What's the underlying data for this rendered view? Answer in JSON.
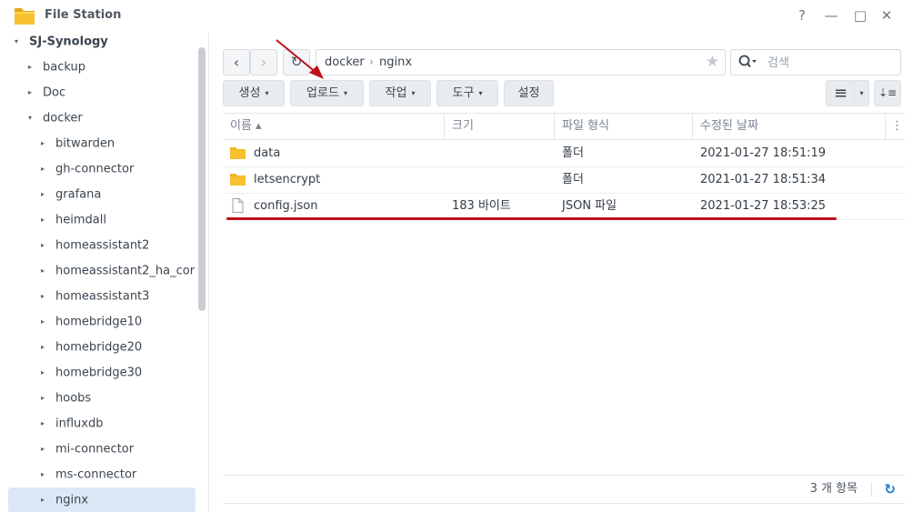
{
  "app": {
    "title": "File Station"
  },
  "window": {
    "help": "?",
    "minimize": "—",
    "maximize": "□",
    "close": "✕"
  },
  "sidebar": {
    "items": [
      {
        "label": "SJ-Synology",
        "arrow": "▾"
      },
      {
        "label": "backup",
        "arrow": "▸"
      },
      {
        "label": "Doc",
        "arrow": "▸"
      },
      {
        "label": "docker",
        "arrow": "▾"
      },
      {
        "label": "bitwarden",
        "arrow": "▸"
      },
      {
        "label": "gh-connector",
        "arrow": "▸"
      },
      {
        "label": "grafana",
        "arrow": "▸"
      },
      {
        "label": "heimdall",
        "arrow": "▸"
      },
      {
        "label": "homeassistant2",
        "arrow": "▸"
      },
      {
        "label": "homeassistant2_ha_cor",
        "arrow": "▸"
      },
      {
        "label": "homeassistant3",
        "arrow": "▸"
      },
      {
        "label": "homebridge10",
        "arrow": "▸"
      },
      {
        "label": "homebridge20",
        "arrow": "▸"
      },
      {
        "label": "homebridge30",
        "arrow": "▸"
      },
      {
        "label": "hoobs",
        "arrow": "▸"
      },
      {
        "label": "influxdb",
        "arrow": "▸"
      },
      {
        "label": "mi-connector",
        "arrow": "▸"
      },
      {
        "label": "ms-connector",
        "arrow": "▸"
      },
      {
        "label": "nginx",
        "arrow": "▸"
      }
    ]
  },
  "navigation": {
    "back": "‹",
    "forward": "›",
    "refresh": "↻"
  },
  "path": {
    "segments": [
      "docker",
      "nginx"
    ],
    "separator": "›",
    "favorite": "★"
  },
  "search": {
    "placeholder": "검색",
    "value": ""
  },
  "toolbar": {
    "create": "생성",
    "upload": "업로드",
    "action": "작업",
    "tools": "도구",
    "settings": "설정",
    "caret": "▾",
    "view_list": "≡",
    "view_caret": "▾",
    "sort": "⇣≡"
  },
  "table": {
    "columns": {
      "name": "이름 ▴",
      "size": "크기",
      "type": "파일 형식",
      "modified": "수정된 날짜"
    },
    "rows": [
      {
        "name": "data",
        "size": "",
        "type": "폴더",
        "modified": "2021-01-27 18:51:19",
        "icon": "folder-icon"
      },
      {
        "name": "letsencrypt",
        "size": "",
        "type": "폴더",
        "modified": "2021-01-27 18:51:34",
        "icon": "folder-icon"
      },
      {
        "name": "config.json",
        "size": "183 바이트",
        "type": "JSON 파일",
        "modified": "2021-01-27 18:53:25",
        "icon": "file-icon"
      }
    ]
  },
  "footer": {
    "count": "3 개 항목",
    "refresh": "↻"
  },
  "colors": {
    "accent": "#1f7bc8",
    "annotation": "#c0111b",
    "folder": "#f5b324",
    "selected": "#dde8f6"
  }
}
